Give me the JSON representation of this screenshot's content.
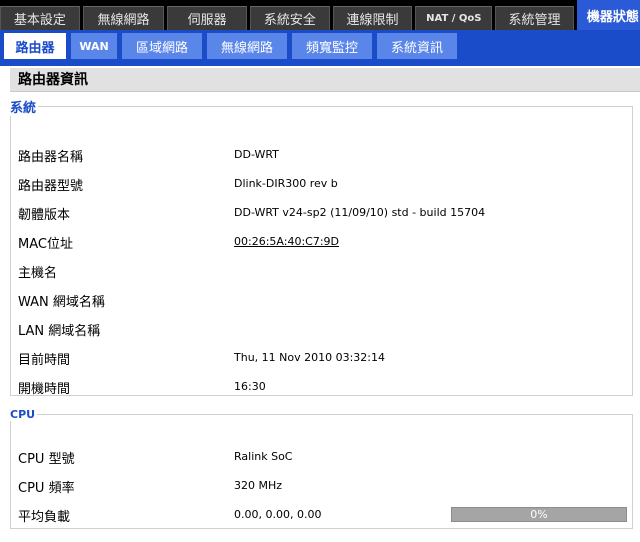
{
  "top_nav": [
    "基本設定",
    "無線網路",
    "伺服器",
    "系統安全",
    "連線限制",
    "NAT / QoS",
    "系統管理",
    "機器狀態"
  ],
  "sub_nav": [
    "路由器",
    "WAN",
    "區域網路",
    "無線網路",
    "頻寬監控",
    "系統資訊"
  ],
  "page_title": "路由器資訊",
  "system": {
    "legend": "系統",
    "rows": [
      {
        "label": "路由器名稱",
        "value": "DD-WRT"
      },
      {
        "label": "路由器型號",
        "value": "Dlink-DIR300 rev b"
      },
      {
        "label": "韌體版本",
        "value": "DD-WRT v24-sp2 (11/09/10) std - build 15704"
      },
      {
        "label": "MAC位址",
        "value": "00:26:5A:40:C7:9D"
      },
      {
        "label": "主機名",
        "value": ""
      },
      {
        "label": "WAN 網域名稱",
        "value": ""
      },
      {
        "label": "LAN 網域名稱",
        "value": ""
      },
      {
        "label": "目前時間",
        "value": "Thu, 11 Nov 2010 03:32:14"
      },
      {
        "label": "開機時間",
        "value": "16:30"
      }
    ]
  },
  "cpu": {
    "legend": "CPU",
    "rows": [
      {
        "label": "CPU 型號",
        "value": "Ralink SoC"
      },
      {
        "label": "CPU 頻率",
        "value": "320 MHz"
      },
      {
        "label": "平均負載",
        "value": "0.00, 0.00, 0.00"
      }
    ],
    "load_bar": {
      "percent": 0,
      "label": "0%"
    }
  }
}
